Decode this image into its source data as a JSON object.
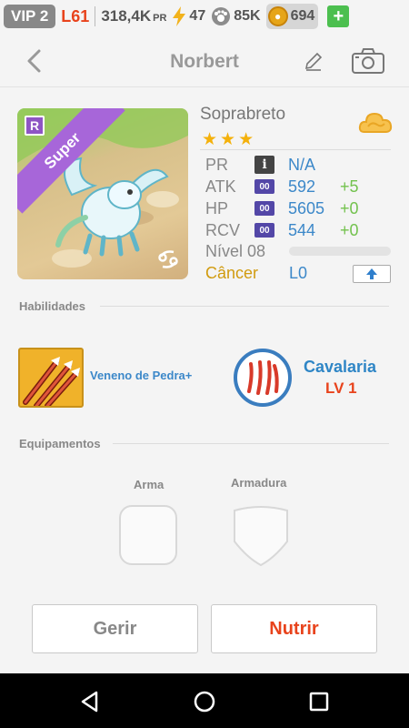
{
  "status": {
    "vip": "VIP 2",
    "level": "L61",
    "power_value": "318,4K",
    "power_unit": "PR",
    "energy": "47",
    "paws": "85K",
    "coins": "694",
    "add": "+"
  },
  "header": {
    "title": "Norbert"
  },
  "pet": {
    "species": "Soprabreto",
    "rank_badge": "R",
    "rarity": "Super",
    "stars": [
      "★",
      "★",
      "★"
    ],
    "stats": [
      {
        "label": "PR",
        "icon": "i",
        "value": "N/A",
        "bonus": ""
      },
      {
        "label": "ATK",
        "icon": "00",
        "value": "592",
        "bonus": "+5"
      },
      {
        "label": "HP",
        "icon": "00",
        "value": "5605",
        "bonus": "+0"
      },
      {
        "label": "RCV",
        "icon": "00",
        "value": "544",
        "bonus": "+0"
      }
    ],
    "level_label": "Nível 08",
    "xp_fraction": 0,
    "sign": "Câncer",
    "sign_level": "L0"
  },
  "abilities": {
    "heading": "Habilidades",
    "skill1": "Veneno de Pedra+",
    "skill2": {
      "name": "Cavalaria",
      "level": "LV 1"
    }
  },
  "equipment": {
    "heading": "Equipamentos",
    "weapon": "Arma",
    "armor": "Armadura"
  },
  "actions": {
    "manage": "Gerir",
    "feed": "Nutrir"
  },
  "colors": {
    "accent_blue": "#3c88c9",
    "accent_red": "#e8431c",
    "rarity_purple": "#a766d9",
    "star_gold": "#f4b10b",
    "bonus_green": "#73c24e"
  }
}
